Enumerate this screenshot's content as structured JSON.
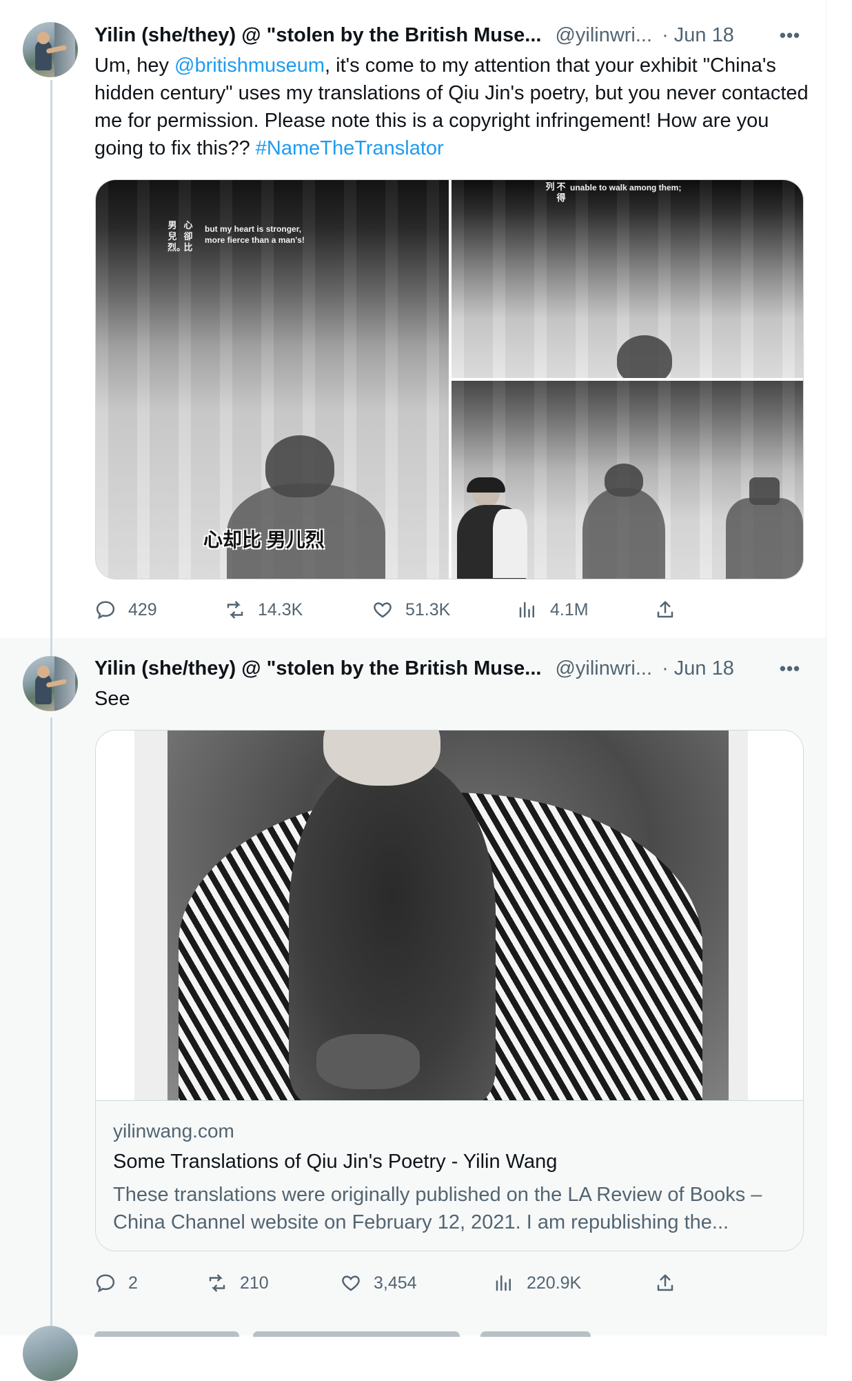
{
  "tweets": [
    {
      "author_name": "Yilin (she/they) @ \"stolen by the British Muse...",
      "handle": "@yilinwri...",
      "date": "· Jun 18",
      "more": "•••",
      "text": {
        "part1": "Um, hey ",
        "mention": "@britishmuseum",
        "part2": ", it's come to my attention that your exhibit \"China's hidden century\" uses my translations of Qiu Jin's poetry, but you never contacted me for permission. Please note this is a copyright infringement! How are you going to fix this?? ",
        "hashtag": "#NameTheTranslator"
      },
      "media": {
        "panel1_overlay_en": [
          "but my heart is stronger,",
          "more fierce than a man's!"
        ],
        "panel1_overlay_cjk": [
          "男兒烈。",
          "心卻比"
        ],
        "panel1_caption": "心却比 男儿烈",
        "panel2_overlay_en": "unable to walk among them;",
        "panel2_overlay_cjk": [
          "不得",
          "列"
        ]
      },
      "stats": {
        "replies": "429",
        "reposts": "14.3K",
        "likes": "51.3K",
        "views": "4.1M"
      }
    },
    {
      "author_name": "Yilin (she/they) @ \"stolen by the British Muse...",
      "handle": "@yilinwri...",
      "date": "· Jun 18",
      "more": "•••",
      "text": "See",
      "card": {
        "domain": "yilinwang.com",
        "title": "Some Translations of Qiu Jin's Poetry - Yilin Wang",
        "description": "These translations were originally published on the LA Review of Books – China Channel website on February 12, 2021. I am republishing the..."
      },
      "stats": {
        "replies": "2",
        "reposts": "210",
        "likes": "3,454",
        "views": "220.9K"
      }
    }
  ],
  "colors": {
    "link": "#1d9bf0",
    "muted": "#536471",
    "text": "#0f1419",
    "border": "#cfd9de",
    "thread_line": "#cfd9de"
  },
  "icons": [
    "reply-icon",
    "repost-icon",
    "like-icon",
    "views-icon",
    "share-icon",
    "more-icon"
  ]
}
